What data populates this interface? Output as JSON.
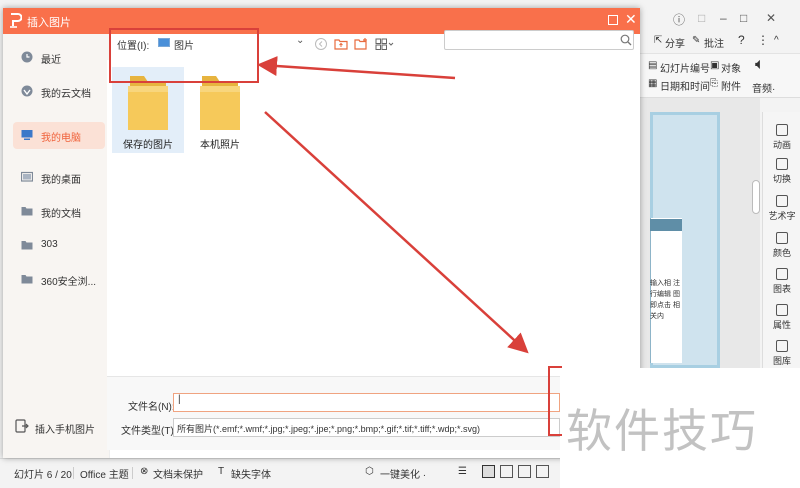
{
  "dialog": {
    "title": "插入图片",
    "close_glyph": "✕"
  },
  "sidebar": {
    "items": [
      {
        "label": "最近",
        "icon": "clock-icon"
      },
      {
        "label": "我的云文档",
        "icon": "cloud-icon"
      },
      {
        "label": "我的电脑",
        "icon": "computer-icon",
        "active": true
      },
      {
        "label": "我的桌面",
        "icon": "desktop-icon"
      },
      {
        "label": "我的文档",
        "icon": "folder-icon"
      },
      {
        "label": "303",
        "icon": "folder-icon"
      },
      {
        "label": "360安全浏...",
        "icon": "folder-icon"
      }
    ],
    "phone_label": "插入手机图片"
  },
  "location": {
    "label": "位置(I):",
    "value": "图片",
    "dropdown_glyph": "⌄"
  },
  "files": [
    {
      "name": "保存的图片",
      "selected": true
    },
    {
      "name": "本机照片",
      "selected": false
    }
  ],
  "form": {
    "filename_label": "文件名(N):",
    "filename_value": "|",
    "filetype_label": "文件类型(T):",
    "filetype_value": "所有图片(*.emf;*.wmf;*.jpg;*.jpeg;*.jpe;*.png;*.bmp;*.gif;*.tif;*.tiff;*.wdp;*.svg)"
  },
  "app": {
    "title_controls": [
      "ⓘ",
      "□",
      "–",
      "□",
      "✕"
    ],
    "toolbar": {
      "share": "分享",
      "annotate": "批注",
      "help": "?",
      "more": "⋮",
      "collapse": "^"
    },
    "ribbon": {
      "slide_number": "幻灯片编号",
      "object": "对象",
      "date_time": "日期和时间",
      "attachment": "附件",
      "audio": "音频·"
    },
    "right_panel": [
      "动画",
      "切换",
      "艺术字",
      "颜色",
      "图表",
      "属性",
      "图库"
    ],
    "slide_text": "输入相 注行编辑 图即点击 相关内"
  },
  "status": {
    "slide": "幻灯片 6 / 20",
    "theme": "Office 主题",
    "protect": "文档未保护",
    "font": "缺失字体",
    "beautify": "一键美化 ·"
  },
  "watermark": "软件技巧",
  "colors": {
    "dialog_titlebar": "#f9704b",
    "sidebar_active_bg": "#fbe1d6",
    "sidebar_active_text": "#f0623b",
    "annotation_red": "#d9403a",
    "folder_yellow": "#f6c95a"
  }
}
